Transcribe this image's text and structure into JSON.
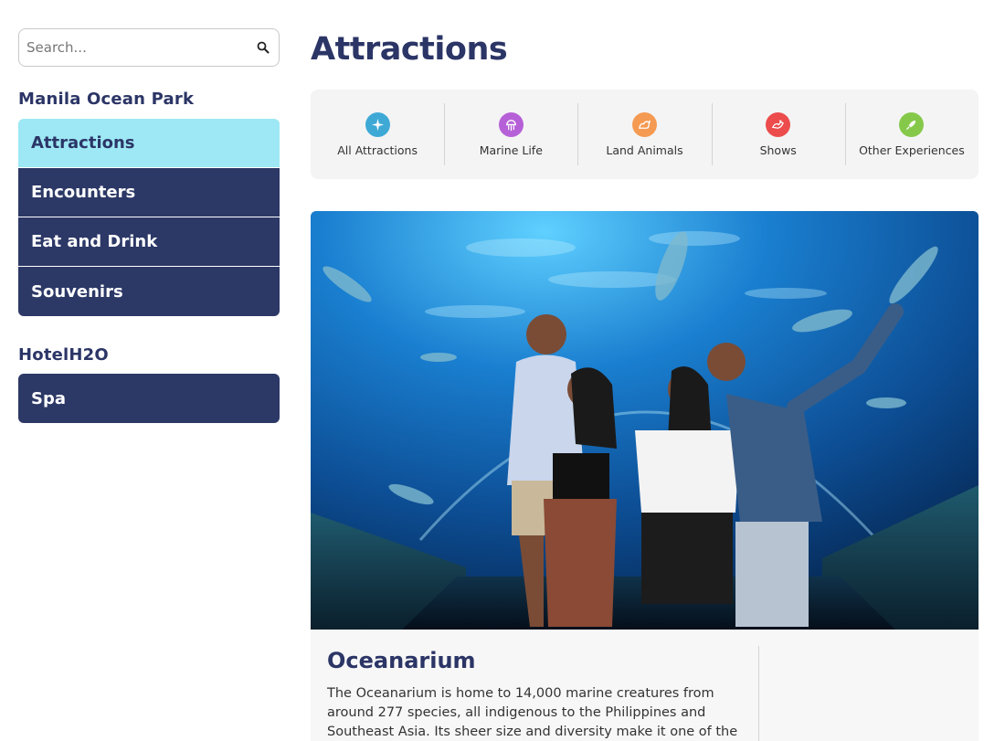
{
  "search": {
    "placeholder": "Search..."
  },
  "sidebar": {
    "groups": [
      {
        "title": "Manila Ocean Park",
        "items": [
          {
            "label": "Attractions",
            "active": true
          },
          {
            "label": "Encounters"
          },
          {
            "label": "Eat and Drink"
          },
          {
            "label": "Souvenirs"
          }
        ]
      },
      {
        "title": "HotelH2O",
        "items": [
          {
            "label": "Spa"
          }
        ]
      }
    ]
  },
  "main": {
    "title": "Attractions",
    "categories": [
      {
        "label": "All Attractions",
        "icon": "sparkle-icon",
        "color": "#3fa9d6"
      },
      {
        "label": "Marine Life",
        "icon": "jellyfish-icon",
        "color": "#b660d8"
      },
      {
        "label": "Land Animals",
        "icon": "animal-icon",
        "color": "#f59a52"
      },
      {
        "label": "Shows",
        "icon": "show-icon",
        "color": "#ec4c4c"
      },
      {
        "label": "Other Experiences",
        "icon": "rocket-icon",
        "color": "#86c94a"
      }
    ],
    "feature": {
      "title": "Oceanarium",
      "description": "The Oceanarium is home to 14,000 marine creatures from around 277 species, all indigenous to the Philippines and Southeast Asia. Its sheer size and diversity make it one of the"
    }
  },
  "colors": {
    "navy": "#2c3866",
    "active": "#9de8f4",
    "text": "#2b3566"
  }
}
